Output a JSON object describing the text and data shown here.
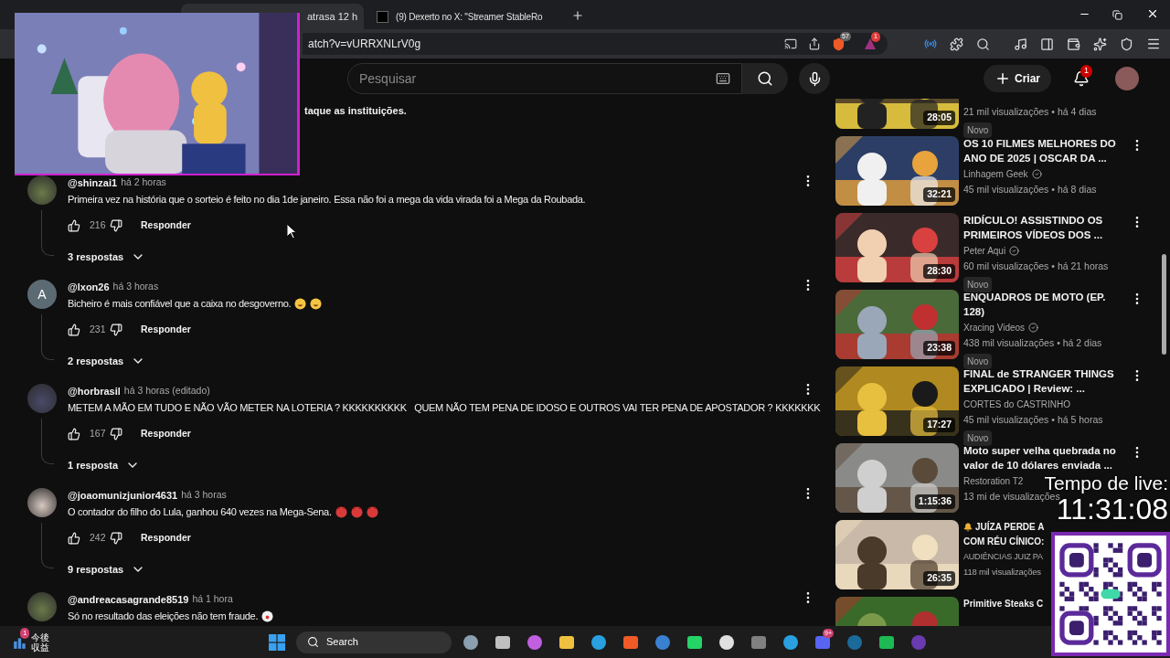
{
  "browser": {
    "tabs": [
      {
        "selected": false
      },
      {
        "title": "atrasa 12 h",
        "selected": true
      },
      {
        "title": "(9) Dexerto no X: \"Streamer StableRo",
        "selected": false
      }
    ],
    "address": "atch?v=vURRXNLrV0g",
    "extension_badges": [
      "57",
      "1"
    ]
  },
  "youtube": {
    "search_placeholder": "Pesquisar",
    "create_label": "Criar",
    "notification_count": "1"
  },
  "comments": {
    "partial_text": "taque as instituições.",
    "items": [
      {
        "author": "@shinzai1",
        "time": "há 2 horas",
        "text": "Primeira vez na história que o sorteio é feito no dia 1de janeiro. Essa não foi a mega da vida virada foi a Mega da Roubada.",
        "likes": "216",
        "reply_label": "Responder",
        "replies": "3 respostas"
      },
      {
        "avatar_letter": "A",
        "author": "@lxon26",
        "time": "há 3 horas",
        "text": "Bicheiro é mais confiável que a caixa no desgoverno.",
        "emoji": [
          {
            "kind": "laugh"
          },
          {
            "kind": "laugh"
          }
        ],
        "likes": "231",
        "reply_label": "Responder",
        "replies": "2 respostas"
      },
      {
        "author": "@horbrasil",
        "time": "há 3 horas (editado)",
        "text": "METEM A MÃO EM TUDO E NÃO VÃO METER NA LOTERIA ? KKKKKKKKKK   QUEM NÃO TEM PENA DE IDOSO E OUTROS VAI TER PENA DE APOSTADOR ? KKKKKKK",
        "likes": "167",
        "reply_label": "Responder",
        "replies": "1 resposta"
      },
      {
        "author": "@joaomunizjunior4631",
        "time": "há 3 horas",
        "text": "O contador do filho do Lula, ganhou 640 vezes na Mega-Sena.",
        "emoji": [
          {
            "kind": "devil"
          },
          {
            "kind": "devil"
          },
          {
            "kind": "devil"
          }
        ],
        "likes": "242",
        "reply_label": "Responder",
        "replies": "9 respostas"
      },
      {
        "author": "@andreacasagrande8519",
        "time": "há 1 hora",
        "text": "Só no resultado das eleições não tem fraude.",
        "emoji": [
          {
            "kind": "clown"
          }
        ]
      }
    ]
  },
  "sidebar": {
    "videos": [
      {
        "duration": "28:05",
        "stats": "21 mil visualizações • há 4 dias",
        "badge": "Novo"
      },
      {
        "duration": "32:21",
        "title": "OS 10 FILMES MELHORES DO ANO DE 2025 | OSCAR DA ...",
        "channel": "Linhagem Geek",
        "verified": true,
        "stats": "45 mil visualizações • há 8 dias"
      },
      {
        "duration": "28:30",
        "title": "RIDÍCULO! ASSISTINDO OS PRIMEIROS VÍDEOS DOS ...",
        "channel": "Peter Aqui",
        "verified": true,
        "stats": "60 mil visualizações • há 21 horas",
        "badge": "Novo"
      },
      {
        "duration": "23:38",
        "title": "ENQUADROS DE MOTO (EP. 128)",
        "channel": "Xracing Videos",
        "verified": true,
        "stats": "438 mil visualizações • há 2 dias",
        "badge": "Novo"
      },
      {
        "duration": "17:27",
        "title": "FINAL de STRANGER THINGS EXPLICADO | Review: ...",
        "channel": "CORTES do CASTRINHO",
        "verified": false,
        "stats": "45 mil visualizações • há 5 horas",
        "badge": "Novo"
      },
      {
        "duration": "1:15:36",
        "title": "Moto super velha quebrada no valor de 10 dólares enviada ...",
        "channel": "Restoration T2",
        "verified": false,
        "stats": "13 mi de visualizações"
      },
      {
        "duration": "26:35",
        "bell": true,
        "title": "JUÍZA PERDE A COM RÉU CÍNICO:",
        "channel": "AUDIÊNCIAS JUIZ PA",
        "verified": false,
        "stats": "118 mil visualizações"
      },
      {
        "title": "Primitive Steaks C"
      }
    ]
  },
  "overlay": {
    "timer_label": "Tempo de live:",
    "timer": "11:31:08"
  },
  "taskbar": {
    "widget_badge": "1",
    "widget_lines": [
      "今後",
      "収益"
    ],
    "search": "Search",
    "discord_badge": "9+"
  }
}
